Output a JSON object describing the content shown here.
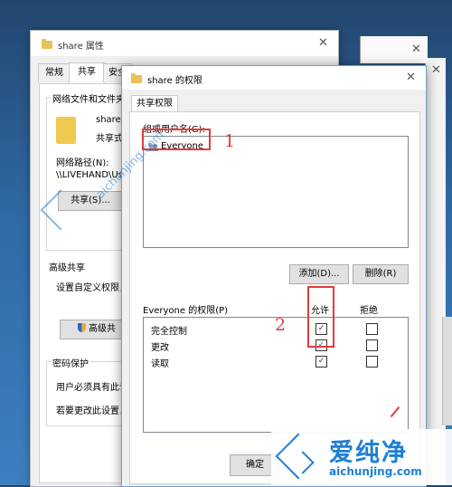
{
  "props_window": {
    "title": "share 属性",
    "close_glyph": "✕",
    "tabs": [
      "常规",
      "共享",
      "安全"
    ],
    "section_network": "网络文件和文件夹",
    "folder_name": "share",
    "folder_state": "共享式",
    "network_path_label": "网络路径(N):",
    "network_path_value": "\\\\LIVEHAND\\Us",
    "share_button": "共享(S)...",
    "advanced_section": "高级共享",
    "advanced_desc": "设置自定义权限，",
    "advanced_button": "高级共",
    "password_section": "密码保护",
    "password_line1": "用户必须具有此计",
    "password_line2": "若要更改此设置，"
  },
  "perm_dialog": {
    "title": "share 的权限",
    "close_glyph": "✕",
    "tab": "共享权限",
    "group_label": "组或用户名(G):",
    "users": [
      "Everyone"
    ],
    "add_button": "添加(D)...",
    "remove_button": "删除(R)",
    "permissions_for": "Everyone 的权限(P)",
    "allow_header": "允许",
    "deny_header": "拒绝",
    "permissions": [
      {
        "name": "完全控制",
        "allow": true,
        "deny": false
      },
      {
        "name": "更改",
        "allow": true,
        "deny": false
      },
      {
        "name": "读取",
        "allow": true,
        "deny": false
      }
    ],
    "ok_button": "确定"
  },
  "annotations": {
    "marker_1": "1",
    "marker_2": "2",
    "color": "#e23b3b"
  },
  "right_edge": {
    "partial_label": "高级共享",
    "close_glyph": "✕"
  },
  "watermark": {
    "brand": "爱纯净",
    "url": "aichunjing.com",
    "diagonal_text": "aichunjing.com",
    "color": "#1e7fd6"
  }
}
